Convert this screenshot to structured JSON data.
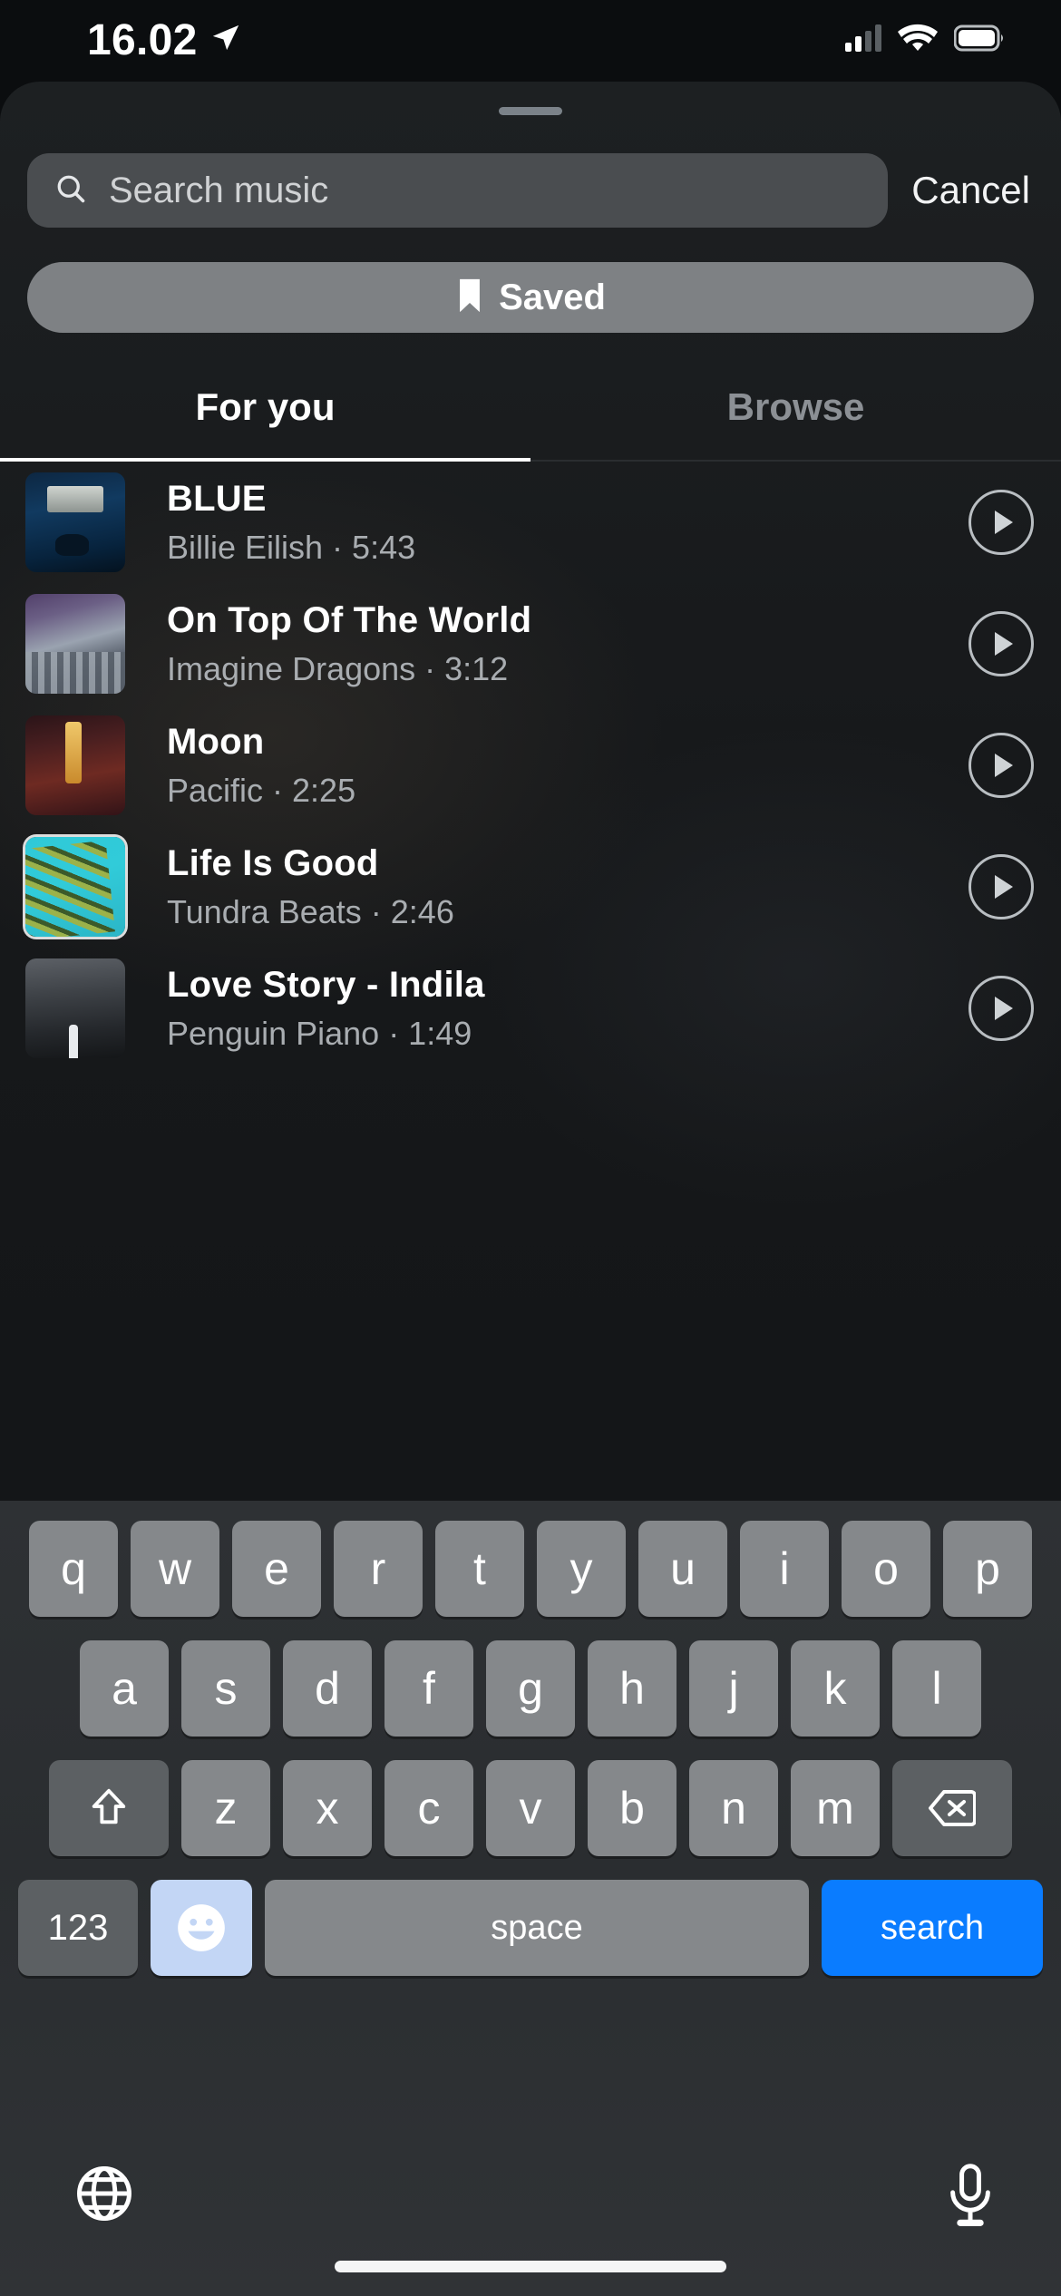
{
  "status_bar": {
    "time": "16.02",
    "location_icon": "location-arrow-icon",
    "cellular_icon": "cellular-signal-icon",
    "wifi_icon": "wifi-icon",
    "battery_icon": "battery-icon"
  },
  "sheet": {
    "grabber": "sheet-grabber"
  },
  "search": {
    "icon": "search-icon",
    "placeholder": "Search music",
    "value": "",
    "cancel_label": "Cancel"
  },
  "saved": {
    "icon": "bookmark-icon",
    "label": "Saved"
  },
  "tabs": [
    {
      "label": "For you",
      "active": true
    },
    {
      "label": "Browse",
      "active": false
    }
  ],
  "songs": [
    {
      "title": "BLUE",
      "meta": "Billie Eilish · 5:43",
      "art": "art-blue",
      "framed": false,
      "play_icon": "play-icon"
    },
    {
      "title": "On Top Of The World",
      "meta": "Imagine Dragons · 3:12",
      "art": "art-dragons",
      "framed": false,
      "play_icon": "play-icon"
    },
    {
      "title": "Moon",
      "meta": "Pacific · 2:25",
      "art": "art-moon",
      "framed": false,
      "play_icon": "play-icon"
    },
    {
      "title": "Life Is Good",
      "meta": "Tundra Beats · 2:46",
      "art": "art-palm",
      "framed": true,
      "play_icon": "play-icon"
    },
    {
      "title": "Love Story - Indila",
      "meta": "Penguin Piano · 1:49",
      "art": "art-night",
      "framed": false,
      "play_icon": "play-icon"
    }
  ],
  "keyboard": {
    "row1": [
      "q",
      "w",
      "e",
      "r",
      "t",
      "y",
      "u",
      "i",
      "o",
      "p"
    ],
    "row2": [
      "a",
      "s",
      "d",
      "f",
      "g",
      "h",
      "j",
      "k",
      "l"
    ],
    "row3_letters": [
      "z",
      "x",
      "c",
      "v",
      "b",
      "n",
      "m"
    ],
    "shift_icon": "shift-arrow-icon",
    "backspace_icon": "backspace-icon",
    "numbers_label": "123",
    "emoji_icon": "emoji-smiley-icon",
    "space_label": "space",
    "search_label": "search",
    "globe_icon": "globe-icon",
    "mic_icon": "microphone-icon",
    "accent_color": "#0a7cff",
    "emoji_key_color": "#c3d6f5"
  },
  "home_indicator": "home-indicator"
}
